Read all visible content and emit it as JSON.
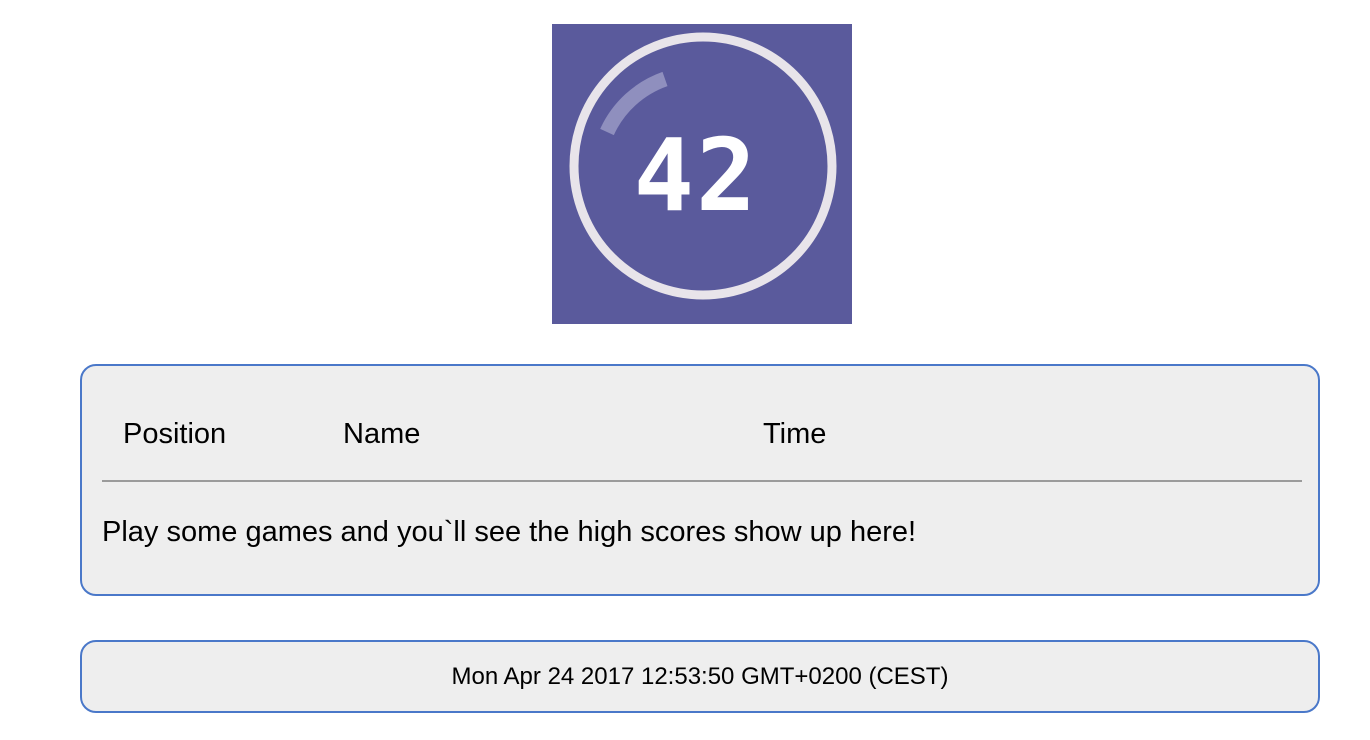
{
  "logo": {
    "icon": "game-logo-42",
    "text": "42",
    "background_color": "#5a5a9c",
    "ring_color": "#e8e4ea"
  },
  "scores": {
    "columns": [
      "Position",
      "Name",
      "Time"
    ],
    "rows": [],
    "empty_message": "Play some games and you`ll see the high scores show up here!"
  },
  "footer": {
    "date_text": "Mon Apr 24 2017 12:53:50 GMT+0200 (CEST)"
  },
  "colors": {
    "panel_border": "#4a78c9",
    "panel_background": "#eeeeee",
    "divider": "#9b9b9b"
  }
}
